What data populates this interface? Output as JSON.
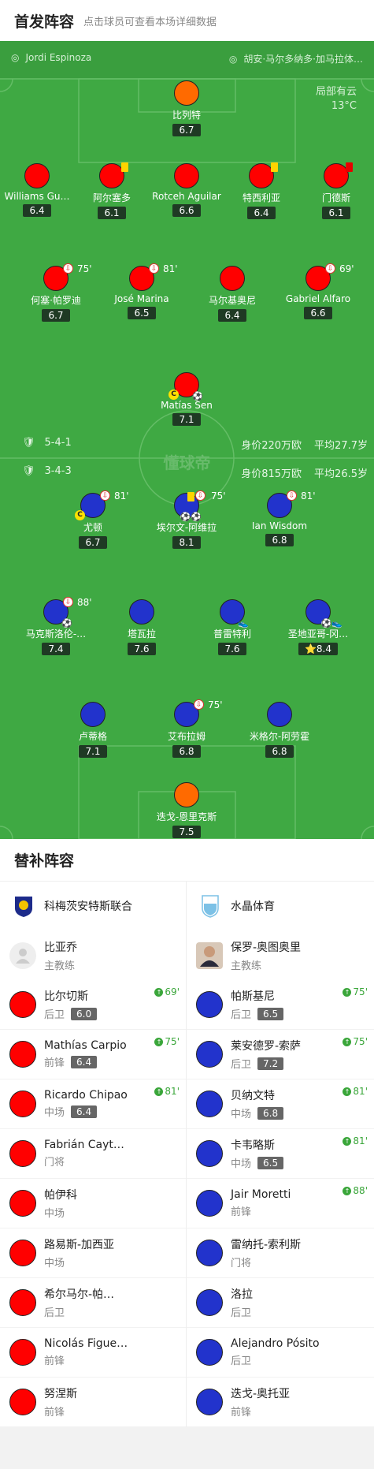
{
  "header": {
    "title": "首发阵容",
    "subtitle": "点击球员可查看本场详细数据"
  },
  "field": {
    "home_coach": "Jordi Espinoza",
    "away_coach": "胡安·马尔多纳多·加马拉体…",
    "weather": "局部有云",
    "temperature": "13°C",
    "watermark": "懂球帝",
    "home_formation": {
      "system": "5-4-1",
      "value": "身价220万欧",
      "age": "平均27.7岁"
    },
    "away_formation": {
      "system": "3-4-3",
      "value": "身价815万欧",
      "age": "平均26.5岁"
    }
  },
  "home_players": [
    {
      "name": "比列特",
      "rating": "6.7",
      "color": "orange"
    },
    {
      "name": "Williams Gu…",
      "rating": "6.4",
      "color": "red"
    },
    {
      "name": "阿尔塞多",
      "rating": "6.1",
      "color": "red",
      "card": "yellow"
    },
    {
      "name": "Rotceh Aguilar",
      "rating": "6.6",
      "color": "red"
    },
    {
      "name": "特西利亚",
      "rating": "6.4",
      "color": "red",
      "card": "yellow"
    },
    {
      "name": "门德斯",
      "rating": "6.1",
      "color": "red",
      "card": "red"
    },
    {
      "name": "何塞·帕罗迪",
      "rating": "6.7",
      "color": "red",
      "sub": "75'"
    },
    {
      "name": "José Marina",
      "rating": "6.5",
      "color": "red",
      "sub": "81'"
    },
    {
      "name": "马尔基奥尼",
      "rating": "6.4",
      "color": "red"
    },
    {
      "name": "Gabriel Alfaro",
      "rating": "6.6",
      "color": "red",
      "sub": "69'"
    },
    {
      "name": "Matías Sen",
      "rating": "7.1",
      "color": "red",
      "captain": "C"
    }
  ],
  "away_players": [
    {
      "name": "尤顿",
      "rating": "6.7",
      "color": "blue",
      "sub": "81'",
      "captain": "C"
    },
    {
      "name": "埃尔文-阿维拉",
      "rating": "8.1",
      "color": "blue",
      "sub": "75'",
      "card": "yellow"
    },
    {
      "name": "Ian Wisdom",
      "rating": "6.8",
      "color": "blue",
      "sub": "81'"
    },
    {
      "name": "马克斯洛伦-…",
      "rating": "7.4",
      "color": "blue",
      "sub": "88'"
    },
    {
      "name": "塔瓦拉",
      "rating": "7.6",
      "color": "blue"
    },
    {
      "name": "普雷特利",
      "rating": "7.6",
      "color": "blue"
    },
    {
      "name": "圣地亚哥-冈…",
      "rating": "8.4",
      "color": "blue",
      "star": "⭐"
    },
    {
      "name": "卢蒂格",
      "rating": "7.1",
      "color": "blue"
    },
    {
      "name": "艾布拉姆",
      "rating": "6.8",
      "color": "blue",
      "sub": "75'"
    },
    {
      "name": "米格尔-阿劳霍",
      "rating": "6.8",
      "color": "blue"
    },
    {
      "name": "迭戈-恩里克斯",
      "rating": "7.5",
      "color": "orange"
    }
  ],
  "bench": {
    "title": "替补阵容",
    "home": {
      "team": "科梅茨安特斯联合",
      "coach": {
        "name": "比亚乔",
        "role": "主教练"
      },
      "players": [
        {
          "name": "比尔切斯",
          "pos": "后卫",
          "rating": "6.0",
          "sub": "69'"
        },
        {
          "name": "Mathías Carpio",
          "pos": "前锋",
          "rating": "6.4",
          "sub": "75'"
        },
        {
          "name": "Ricardo Chipao",
          "pos": "中场",
          "rating": "6.4",
          "sub": "81'"
        },
        {
          "name": "Fabrián Cayt…",
          "pos": "门将"
        },
        {
          "name": "帕伊科",
          "pos": "中场"
        },
        {
          "name": "路易斯-加西亚",
          "pos": "中场"
        },
        {
          "name": "希尔马尔-帕…",
          "pos": "后卫"
        },
        {
          "name": "Nicolás Figue…",
          "pos": "前锋"
        },
        {
          "name": "努涅斯",
          "pos": "前锋"
        }
      ]
    },
    "away": {
      "team": "水晶体育",
      "coach": {
        "name": "保罗-奥图奥里",
        "role": "主教练"
      },
      "players": [
        {
          "name": "帕斯基尼",
          "pos": "后卫",
          "rating": "6.5",
          "sub": "75'"
        },
        {
          "name": "莱安德罗-索萨",
          "pos": "后卫",
          "rating": "7.2",
          "sub": "75'"
        },
        {
          "name": "贝纳文特",
          "pos": "中场",
          "rating": "6.8",
          "sub": "81'"
        },
        {
          "name": "卡韦略斯",
          "pos": "中场",
          "rating": "6.5",
          "sub": "81'"
        },
        {
          "name": "Jair Moretti",
          "pos": "前锋",
          "sub": "88'"
        },
        {
          "name": "雷纳托-索利斯",
          "pos": "门将"
        },
        {
          "name": "洛拉",
          "pos": "后卫"
        },
        {
          "name": "Alejandro Pósito",
          "pos": "后卫"
        },
        {
          "name": "迭戈-奥托亚",
          "pos": "前锋"
        }
      ]
    }
  }
}
